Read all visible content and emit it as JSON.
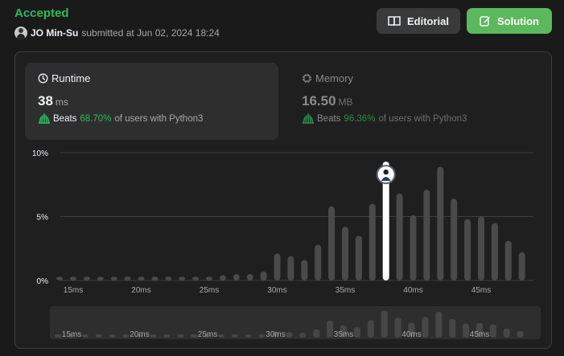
{
  "header": {
    "status": "Accepted",
    "user": "JO Min-Su",
    "submitted_text": "submitted at Jun 02, 2024 18:24"
  },
  "buttons": {
    "editorial": "Editorial",
    "solution": "Solution"
  },
  "runtime": {
    "title": "Runtime",
    "value": "38",
    "unit": "ms",
    "beats_label": "Beats",
    "beats_pct": "68.70%",
    "beats_suffix": "of users with Python3"
  },
  "memory": {
    "title": "Memory",
    "value": "16.50",
    "unit": "MB",
    "beats_label": "Beats",
    "beats_pct": "96.36%",
    "beats_suffix": "of users with Python3"
  },
  "colors": {
    "accepted": "#2cbb5d",
    "solution_button": "#5cb85c",
    "bar": "#4a4a4a",
    "highlight_bar": "#ffffff"
  },
  "chart_data": {
    "type": "bar",
    "x": [
      14,
      15,
      16,
      17,
      18,
      19,
      20,
      21,
      22,
      23,
      24,
      25,
      26,
      27,
      28,
      29,
      30,
      31,
      32,
      33,
      34,
      35,
      36,
      37,
      38,
      39,
      40,
      41,
      42,
      43,
      44,
      45,
      46,
      47,
      48
    ],
    "values": [
      0.3,
      0.3,
      0.3,
      0.3,
      0.3,
      0.3,
      0.3,
      0.3,
      0.3,
      0.3,
      0.3,
      0.3,
      0.4,
      0.5,
      0.5,
      0.7,
      2.1,
      1.9,
      1.6,
      2.8,
      5.8,
      4.2,
      3.5,
      6.0,
      9.3,
      6.8,
      5.1,
      7.1,
      8.9,
      6.4,
      4.8,
      5.0,
      4.5,
      3.1,
      2.2
    ],
    "highlight_x": 38,
    "xticks": [
      "15ms",
      "20ms",
      "25ms",
      "30ms",
      "35ms",
      "40ms",
      "45ms"
    ],
    "yticks": [
      "0%",
      "5%",
      "10%"
    ],
    "ylim": [
      0,
      10
    ],
    "unit": "ms"
  }
}
